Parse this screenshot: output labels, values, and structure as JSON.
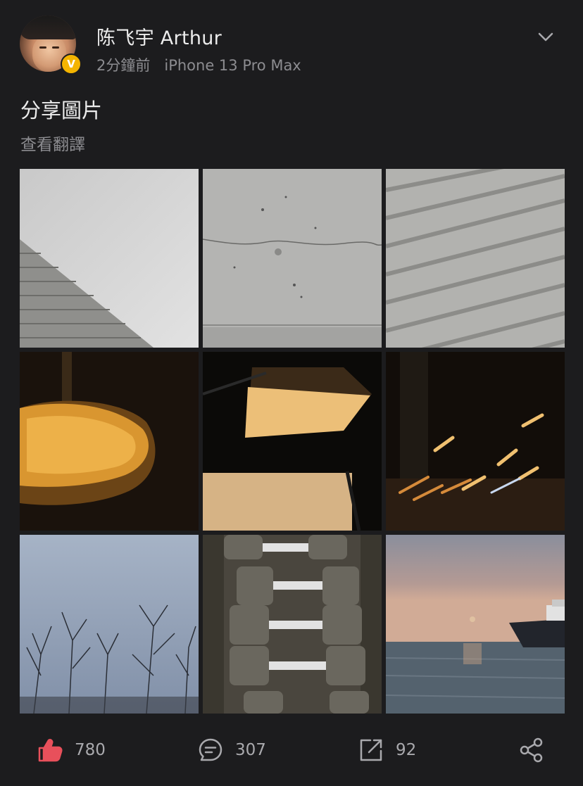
{
  "post": {
    "author": {
      "name": "陈飞宇 Arthur",
      "verified_badge": "V",
      "avatar_icon": "user-avatar"
    },
    "time": "2分鐘前",
    "device": "iPhone 13 Pro Max",
    "menu_icon": "chevron-down-icon",
    "text": "分享圖片",
    "translate_label": "查看翻譯",
    "images": [
      {
        "subject": "white-wall-stairs"
      },
      {
        "subject": "cracked-concrete-wall"
      },
      {
        "subject": "diagonal-concrete-steps"
      },
      {
        "subject": "motion-blur-car-light"
      },
      {
        "subject": "softbox-light"
      },
      {
        "subject": "blurred-night-lights"
      },
      {
        "subject": "bare-trees-sky"
      },
      {
        "subject": "dumbbell-rack"
      },
      {
        "subject": "sea-sunset-boat"
      }
    ],
    "actions": {
      "likes": "780",
      "comments": "307",
      "reposts": "92",
      "like_icon": "thumbs-up-icon",
      "comment_icon": "comment-icon",
      "repost_icon": "repost-icon",
      "share_icon": "share-icon"
    },
    "colors": {
      "background": "#1c1c1e",
      "like_accent": "#e8505b",
      "verified": "#f4b400"
    }
  }
}
